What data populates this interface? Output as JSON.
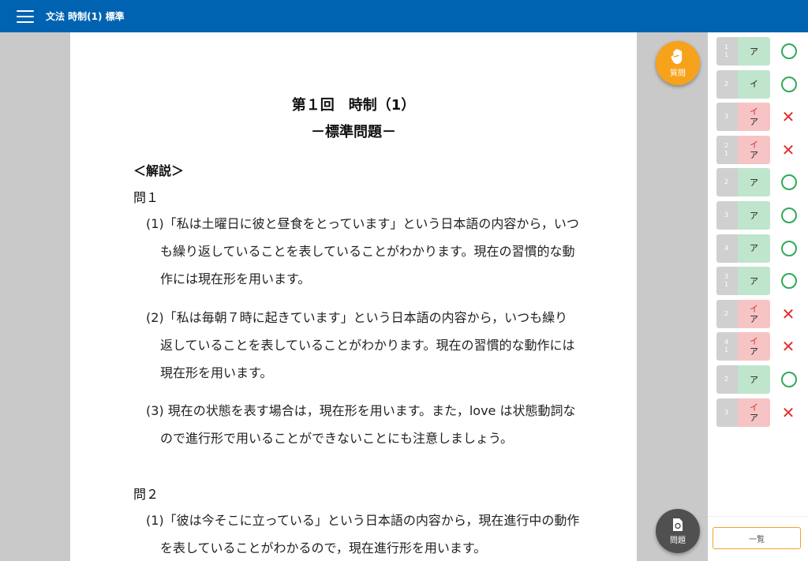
{
  "header": {
    "title": "文法 時制(1) 標準"
  },
  "document": {
    "title": "第１回　時制（1）",
    "subtitle": "－標準問題－",
    "section": "＜解説＞",
    "q1": {
      "label": "問１",
      "items": [
        "(1)「私は土曜日に彼と昼食をとっています」という日本語の内容から，いつも繰り返していることを表していることがわかります。現在の習慣的な動作には現在形を用います。",
        "(2)「私は毎朝７時に起きています」という日本語の内容から，いつも繰り返していることを表していることがわかります。現在の習慣的な動作には現在形を用います。",
        "(3) 現在の状態を表す場合は，現在形を用います。また，love は状態動詞なので進行形で用いることができないことにも注意しましょう。"
      ]
    },
    "q2": {
      "label": "問２",
      "items": [
        "(1)「彼は今そこに立っている」という日本語の内容から，現在進行中の動作を表していることがわかるので，現在進行形を用います。"
      ]
    }
  },
  "fab": {
    "question_label": "質問",
    "problem_label": "問題"
  },
  "answers": [
    {
      "num1": "1",
      "num2": "1",
      "answers": [
        "ア"
      ],
      "correct": true
    },
    {
      "num1": "2",
      "num2": "",
      "answers": [
        "イ"
      ],
      "correct": true
    },
    {
      "num1": "3",
      "num2": "",
      "answers": [
        "イ",
        "ア"
      ],
      "correct": false
    },
    {
      "num1": "2",
      "num2": "1",
      "answers": [
        "イ",
        "ア"
      ],
      "correct": false
    },
    {
      "num1": "2",
      "num2": "",
      "answers": [
        "ア"
      ],
      "correct": true
    },
    {
      "num1": "3",
      "num2": "",
      "answers": [
        "ア"
      ],
      "correct": true
    },
    {
      "num1": "4",
      "num2": "",
      "answers": [
        "ア"
      ],
      "correct": true
    },
    {
      "num1": "3",
      "num2": "1",
      "answers": [
        "ア"
      ],
      "correct": true
    },
    {
      "num1": "2",
      "num2": "",
      "answers": [
        "イ",
        "ア"
      ],
      "correct": false
    },
    {
      "num1": "4",
      "num2": "1",
      "answers": [
        "イ",
        "ア"
      ],
      "correct": false
    },
    {
      "num1": "2",
      "num2": "",
      "answers": [
        "ア"
      ],
      "correct": true
    },
    {
      "num1": "3",
      "num2": "",
      "answers": [
        "イ",
        "ア"
      ],
      "correct": false
    }
  ],
  "panel": {
    "list_label": "一覧"
  },
  "colors": {
    "header": "#0063b1",
    "accent": "#f7a21b",
    "correct": "#2faa5a",
    "wrong": "#e0302b"
  },
  "icons": {
    "menu": "hamburger-icon",
    "question": "hand-icon",
    "problem": "document-refresh-icon",
    "correct": "circle-mark-icon",
    "wrong": "cross-mark-icon"
  }
}
